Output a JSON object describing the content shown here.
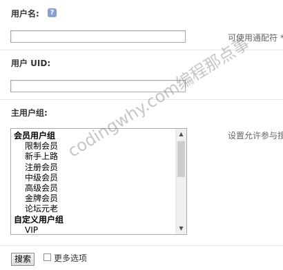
{
  "username": {
    "label": "用户名:",
    "value": "",
    "hint": "可使用通配符 *"
  },
  "uid": {
    "label": "用户 UID:",
    "value": ""
  },
  "group": {
    "label": "主用户组:",
    "hint": "设置允许参与搜",
    "options": [
      {
        "text": "会员用户组",
        "kind": "group"
      },
      {
        "text": "限制会员",
        "kind": "child"
      },
      {
        "text": "新手上路",
        "kind": "child"
      },
      {
        "text": "注册会员",
        "kind": "child"
      },
      {
        "text": "中级会员",
        "kind": "child"
      },
      {
        "text": "高级会员",
        "kind": "child"
      },
      {
        "text": "金牌会员",
        "kind": "child"
      },
      {
        "text": "论坛元老",
        "kind": "child"
      },
      {
        "text": "自定义用户组",
        "kind": "group"
      },
      {
        "text": "VIP",
        "kind": "child"
      }
    ]
  },
  "actions": {
    "search_label": "搜索",
    "more_options_label": "更多选项",
    "more_options_checked": false
  },
  "watermark": "codingwhy.com编程那点事"
}
